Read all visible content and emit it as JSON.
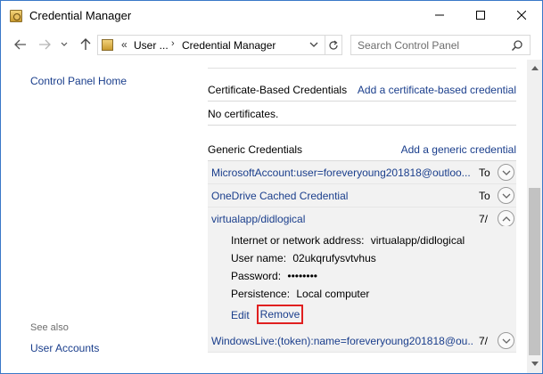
{
  "window": {
    "title": "Credential Manager",
    "icon": "credential-manager-icon"
  },
  "address": {
    "separator": "«",
    "crumbs": [
      "User ...",
      "Credential Manager"
    ],
    "search_placeholder": "Search Control Panel"
  },
  "left_panel": {
    "home_link": "Control Panel Home",
    "see_also_label": "See also",
    "see_also_links": [
      "User Accounts"
    ]
  },
  "certificate_section": {
    "title": "Certificate-Based Credentials",
    "add_link": "Add a certificate-based credential",
    "empty_text": "No certificates."
  },
  "generic_section": {
    "title": "Generic Credentials",
    "add_link": "Add a generic credential",
    "credentials": [
      {
        "name": "MicrosoftAccount:user=foreveryoung201818@outloo...",
        "date": "To",
        "expanded": false
      },
      {
        "name": "OneDrive Cached Credential",
        "date": "To",
        "expanded": false
      },
      {
        "name": "virtualapp/didlogical",
        "date": "7/",
        "expanded": true
      },
      {
        "name": "WindowsLive:(token):name=foreveryoung201818@ou...",
        "date": "7/",
        "expanded": false
      }
    ],
    "details": {
      "address_label": "Internet or network address:",
      "address_value": "virtualapp/didlogical",
      "username_label": "User name:",
      "username_value": "02ukqrufysvtvhus",
      "password_label": "Password:",
      "password_value": "••••••••",
      "persistence_label": "Persistence:",
      "persistence_value": "Local computer",
      "edit_link": "Edit",
      "remove_link": "Remove"
    }
  },
  "colors": {
    "link": "#1a3e8c",
    "row_background": "#f2f2f2",
    "highlight_border": "#e02020",
    "window_border": "#3a78c8"
  }
}
